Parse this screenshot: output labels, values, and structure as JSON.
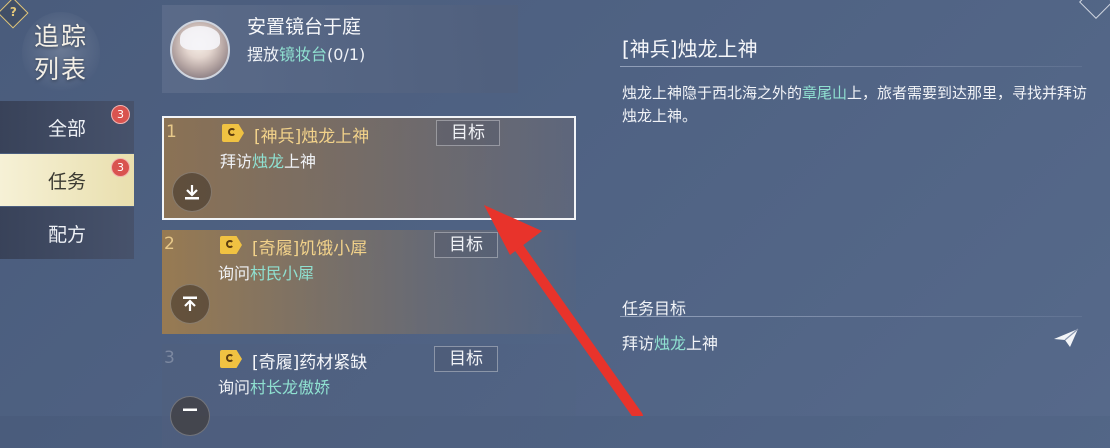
{
  "sidebar": {
    "help_icon": "?",
    "title_line1": "追踪",
    "title_line2": "列表",
    "tabs": [
      {
        "label": "全部",
        "badge": "3",
        "active": false
      },
      {
        "label": "任务",
        "badge": "3",
        "active": true
      },
      {
        "label": "配方",
        "badge": "",
        "active": false
      }
    ]
  },
  "top_quest": {
    "title": "安置镜台于庭",
    "sub_prefix": "摆放",
    "sub_highlight": "镜妆台",
    "sub_suffix": "(0/1)"
  },
  "quests": [
    {
      "num": "1",
      "name": "[神兵]烛龙上神",
      "goal_btn": "目标",
      "desc_prefix": "拜访",
      "desc_highlight": "烛龙",
      "desc_suffix": "上神"
    },
    {
      "num": "2",
      "name": "[奇履]饥饿小犀",
      "goal_btn": "目标",
      "desc_prefix": "询问",
      "desc_highlight": "村民小犀",
      "desc_suffix": ""
    },
    {
      "num": "3",
      "name": "[奇履]药材紧缺",
      "goal_btn": "目标",
      "desc_prefix": "询问",
      "desc_highlight": "村长龙傲娇",
      "desc_suffix": ""
    }
  ],
  "detail": {
    "title": "[神兵]烛龙上神",
    "desc_part1": "烛龙上神隐于西北海之外的",
    "desc_highlight": "章尾山",
    "desc_part2": "上，旅者需要到达那里，寻找并拜访烛龙上神。",
    "goal_label": "任务目标",
    "goal_prefix": "拜访",
    "goal_highlight": "烛龙",
    "goal_suffix": "上神"
  },
  "colors": {
    "highlight": "#8fe0d0",
    "quest_name": "#f2d28a",
    "badge": "#d9534f",
    "annotation_arrow": "#e8332b"
  }
}
